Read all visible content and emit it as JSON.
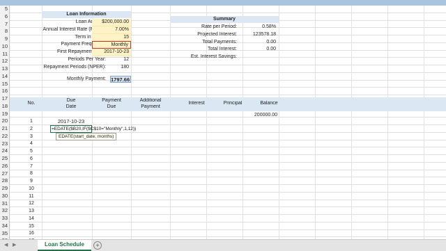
{
  "loan_info": {
    "title": "Loan Information",
    "rows": [
      {
        "label": "Loan Amount:",
        "value": "$200,000.00"
      },
      {
        "label": "Annual Interest Rate (RATE):",
        "value": "7.00%"
      },
      {
        "label": "Term in Years:",
        "value": "15"
      },
      {
        "label": "Payment Frequency:",
        "value": "Monthly"
      },
      {
        "label": "First Repayment Date:",
        "value": "2017-10-23"
      },
      {
        "label": "Periods Per Year:",
        "value": "12"
      },
      {
        "label": "Repayment Periods (NPER):",
        "value": "180"
      }
    ],
    "monthly_payment_label": "Monthly Payment:",
    "monthly_payment_value": "1797.66"
  },
  "summary": {
    "title": "Summary",
    "rows": [
      {
        "label": "Rate per Period:",
        "value": "0.58%"
      },
      {
        "label": "Projected Interest:",
        "value": "123578.18"
      },
      {
        "label": "Total Payments:",
        "value": "0.00"
      },
      {
        "label": "Total Interest:",
        "value": "0.00"
      },
      {
        "label": "Est. Interest Savings:",
        "value": ""
      }
    ]
  },
  "schedule": {
    "headers": {
      "no": "No.",
      "due_date_1": "Due",
      "due_date_2": "Date",
      "payment_due_1": "Payment",
      "payment_due_2": "Due",
      "additional_1": "Additional",
      "additional_2": "Payment",
      "interest": "Interest",
      "principal": "Principal",
      "balance": "Balance"
    },
    "initial_balance": "200000.00",
    "first_due_date": "2017-10-23",
    "numbers": [
      "1",
      "2",
      "3",
      "4",
      "5",
      "6",
      "7",
      "8",
      "9",
      "10",
      "11",
      "12",
      "13",
      "14",
      "15",
      "16",
      "17"
    ],
    "formula": "=EDATE($B20,IF($C$10=\"Monthly\",1,12))",
    "tooltip": "EDATE(start_date, months)"
  },
  "row_numbers": [
    "5",
    "6",
    "7",
    "8",
    "9",
    "10",
    "11",
    "12",
    "13",
    "14",
    "15",
    "16",
    "17",
    "18",
    "19",
    "20",
    "21",
    "22",
    "23",
    "24",
    "25",
    "26",
    "27",
    "28",
    "29",
    "30",
    "31",
    "32",
    "33",
    "34",
    "35",
    "36"
  ],
  "tabs": {
    "active": "Loan Schedule",
    "add": "+"
  },
  "colors": {
    "header_fill": "#dbe7f3",
    "input_fill": "#fdf3c6",
    "selection": "#217346"
  }
}
